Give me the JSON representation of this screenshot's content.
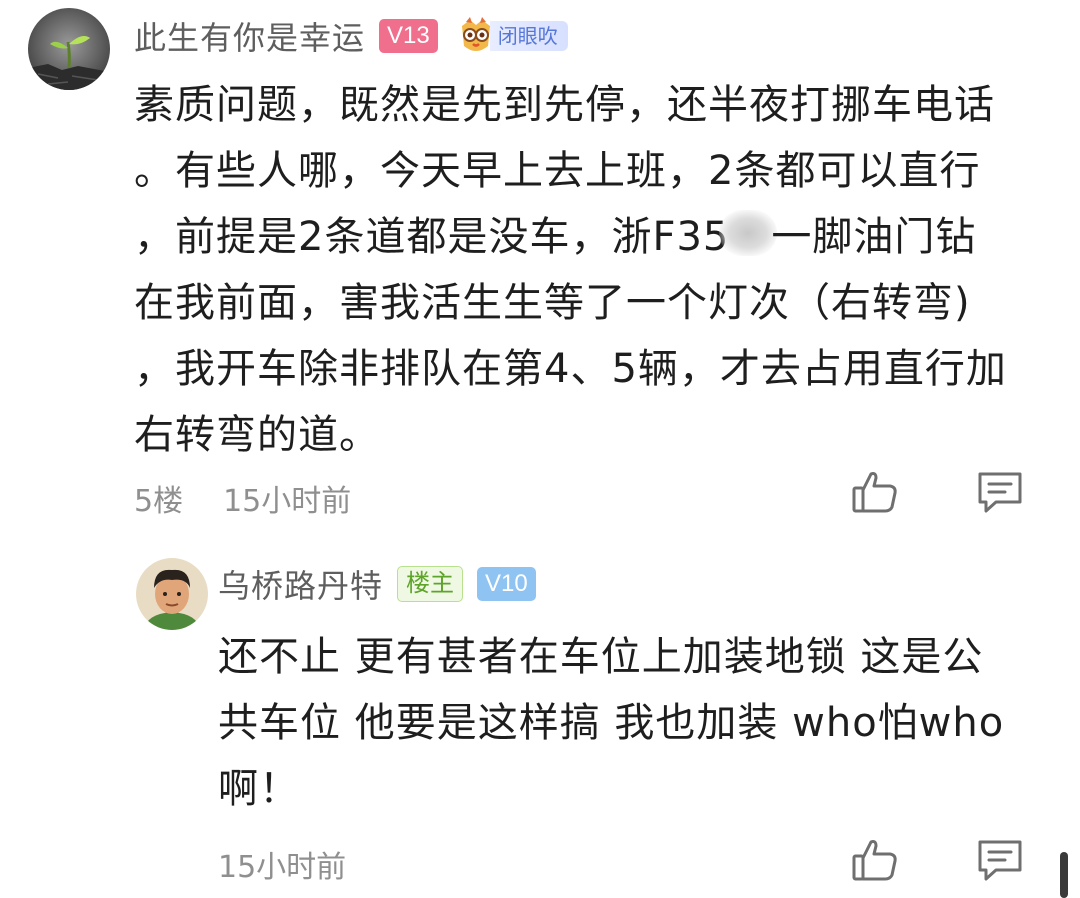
{
  "comments": [
    {
      "author": "此生有你是幸运",
      "level": "V13",
      "level_color": "#ef6f8c",
      "medal_label": "闭眼吹",
      "avatar_icon": "sprout-avatar",
      "text_lines": [
        "素质问题，既然是先到先停，还半夜打挪车电话",
        "。有些人哪，今天早上去上班，2条都可以直行",
        "，前提是2条道都是没车，浙F35",
        "一脚油门钻",
        "在我前面，害我活生生等了一个灯次（右转弯)",
        "，我开车除非排队在第4、5辆，才去占用直行加",
        "右转弯的道。"
      ],
      "floor": "5楼",
      "time": "15小时前",
      "like_icon": "thumbs-up-icon",
      "reply_icon": "comment-icon"
    }
  ],
  "reply": {
    "author": "乌桥路丹特",
    "op_badge": "楼主",
    "level": "V10",
    "level_color": "#8fc3f2",
    "avatar_icon": "cartoon-man-avatar",
    "text_lines": [
      "还不止 更有甚者在车位上加装地锁 这是公",
      "共车位 他要是这样搞 我也加装 who怕who",
      "啊！"
    ],
    "time": "15小时前",
    "like_icon": "thumbs-up-icon",
    "reply_icon": "comment-icon"
  }
}
